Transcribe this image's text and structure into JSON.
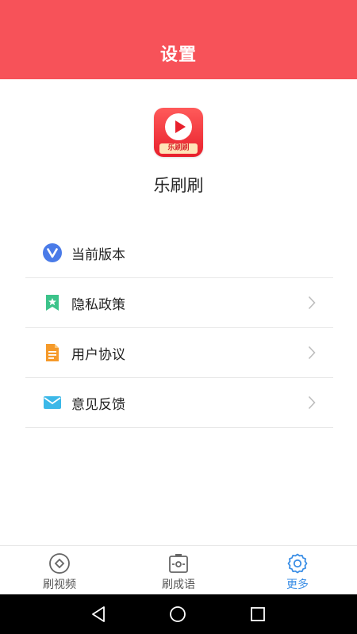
{
  "header": {
    "title": "设置"
  },
  "app": {
    "name": "乐刷刷",
    "logo_caption": "乐刷刷"
  },
  "settings": [
    {
      "label": "当前版本",
      "icon": "version-icon",
      "has_chevron": false
    },
    {
      "label": "隐私政策",
      "icon": "privacy-icon",
      "has_chevron": true
    },
    {
      "label": "用户协议",
      "icon": "agreement-icon",
      "has_chevron": true
    },
    {
      "label": "意见反馈",
      "icon": "feedback-icon",
      "has_chevron": true
    }
  ],
  "bottom_nav": [
    {
      "label": "刷视频",
      "icon": "video-icon",
      "active": false
    },
    {
      "label": "刷成语",
      "icon": "idiom-icon",
      "active": false
    },
    {
      "label": "更多",
      "icon": "gear-icon",
      "active": true
    }
  ],
  "colors": {
    "header_bg": "#f75259",
    "active_tab": "#3a8ee6"
  }
}
